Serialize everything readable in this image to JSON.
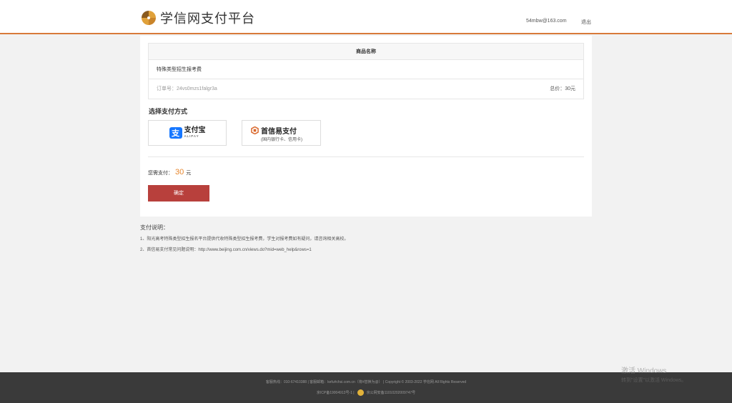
{
  "header": {
    "logo_text": "学信网支付平台",
    "user_email": "54mbw@163.com",
    "logout_label": "退出"
  },
  "order": {
    "column_header": "商品名称",
    "item_name": "特殊类型招生报考费",
    "order_no": "订单号：24vs0mzs1falgr3a",
    "total": "总价：30元"
  },
  "payment": {
    "section_title": "选择支付方式",
    "alipay_name": "支付宝",
    "alipay_sub": "ALIPAY",
    "yeepay_name": "首信易支付",
    "yeepay_sub": "(国内银行卡、信用卡)",
    "amount_prefix": "您需支付：",
    "amount": "30",
    "amount_unit": "元",
    "confirm_label": "确定"
  },
  "notes": {
    "title": "支付说明：",
    "lines": [
      "1、阳光高考特殊类型招生报名平台提供代收特殊类型招生报考费，学生对报考费如有疑问，请咨询相关高校。",
      "2、首信易支付常见问题说明：http://www.beijing.com.cn/views.do?mid=web_help&rows=1"
    ]
  },
  "footer": {
    "line1": "客服热线：010-67410388  |  客服邮箱：kefu#chsi.com.cn（将#替换为@）  |  Copyright © 2003-2022 学信网 All Rights Reserved",
    "icp": "京ICP备19004913号-1  |",
    "police": "京公网安备11010202009747号"
  },
  "os_watermark": {
    "line1": "激活 Windows",
    "line2": "转到\"设置\"以激活 Windows。"
  },
  "colors": {
    "accent": "#d87a3a",
    "confirm": "#b8403c",
    "amount": "#e6852c",
    "alipay_blue": "#1677ff"
  }
}
